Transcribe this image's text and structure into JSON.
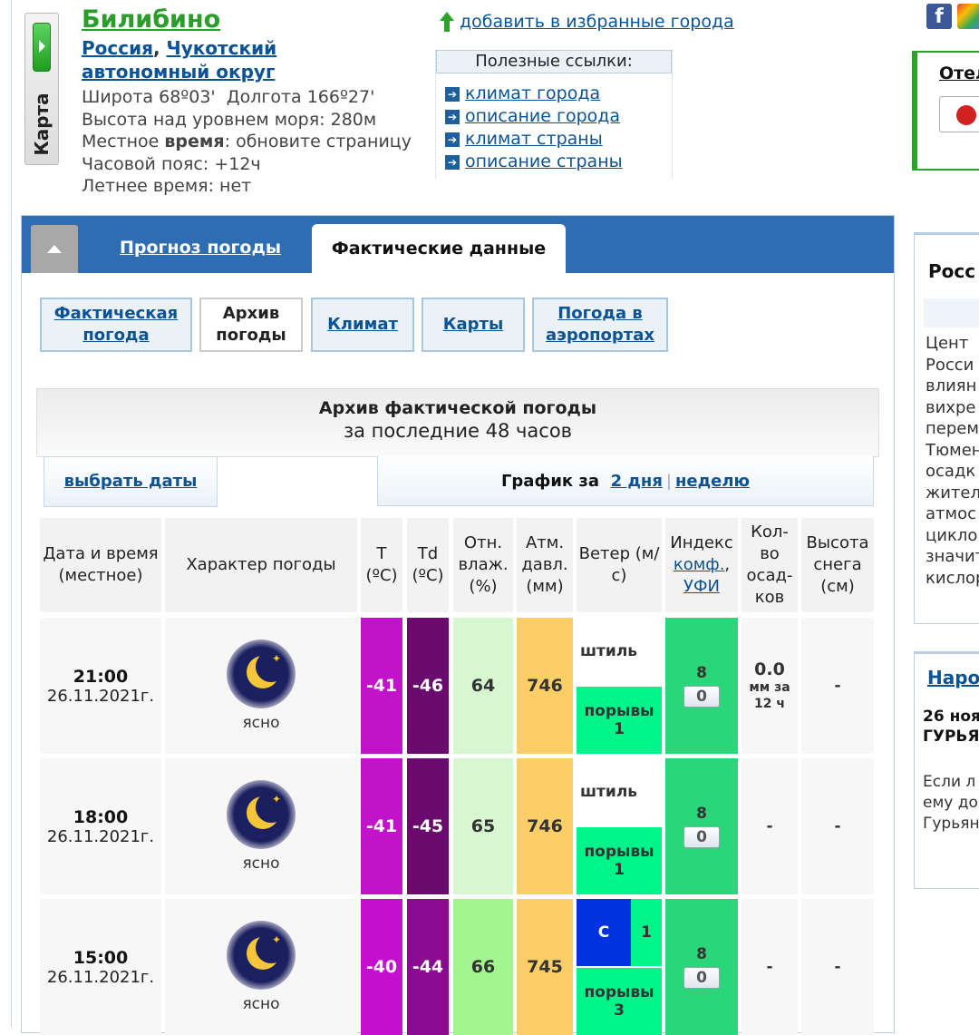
{
  "location": {
    "city": "Билибино",
    "country": "Россия",
    "region": "Чукотский автономный округ",
    "latitude": "Широта 68º03'",
    "longitude": "Долгота 166º27'",
    "altitude": "Высота над уровнем моря: 280м",
    "local_time_label": "Местное ",
    "local_time_bold": "время",
    "local_time_rest": ": обновите страницу",
    "timezone": "Часовой пояс: +12ч",
    "dst": "Летнее время: нет",
    "map_label": "Карта"
  },
  "favorites_link": "добавить в избранные города",
  "useful_links": {
    "title": "Полезные ссылки:",
    "items": [
      "климат города",
      "описание города",
      "климат страны",
      "описание страны"
    ]
  },
  "sidebar": {
    "hotels_title": "Отел",
    "news1_title": "Росс",
    "news1_text": "Цент\nРосси\nвлиян\nвихре\nперем\nТюмен\nосадк\nжител\nатмос\nцикло\nзначит\nкислор",
    "news2_title": "Наро",
    "news2_date": "26 ноя\nГУРЬЯ",
    "news2_text": "Если л\nему до\nГурьян"
  },
  "tabs": {
    "forecast": "Прогноз погоды",
    "actual": "Фактические данные"
  },
  "subtabs": [
    {
      "label": "Фактическая погода",
      "active": false
    },
    {
      "label": "Архив погоды",
      "active": true
    },
    {
      "label": "Климат",
      "active": false
    },
    {
      "label": "Карты",
      "active": false
    },
    {
      "label": "Погода в аэропортах",
      "active": false
    }
  ],
  "archive": {
    "title": "Архив фактической погоды",
    "subtitle": "за последние 48 часов",
    "select_dates": "выбрать даты",
    "graph_label": "График за",
    "graph_2days": "2 дня",
    "graph_week": "неделю"
  },
  "table": {
    "headers": {
      "datetime": "Дата и время (местное)",
      "conditions": "Характер погоды",
      "t": "T (ºC)",
      "td": "Td (ºC)",
      "humidity": "Отн. влаж. (%)",
      "pressure": "Атм. давл. (мм)",
      "wind": "Ветер (м/с)",
      "index_prefix": "Индекс",
      "index_link1": "комф.",
      "index_link2": "УФИ",
      "precip": "Кол-во осад-ков",
      "snow": "Высота снега (см)"
    },
    "rows": [
      {
        "time": "21:00",
        "date": "26.11.2021г.",
        "cond": "ясно",
        "t": "-41",
        "td": "-46",
        "hum": "64",
        "press": "746",
        "wind": "штиль",
        "wind_dir": "",
        "wind_speed": "",
        "gust_label": "порывы",
        "gust": "1",
        "comfort": "8",
        "uv": "0",
        "precip": "0.0",
        "precip_note": "мм за 12 ч",
        "snow": "-"
      },
      {
        "time": "18:00",
        "date": "26.11.2021г.",
        "cond": "ясно",
        "t": "-41",
        "td": "-45",
        "hum": "65",
        "press": "746",
        "wind": "штиль",
        "wind_dir": "",
        "wind_speed": "",
        "gust_label": "порывы",
        "gust": "1",
        "comfort": "8",
        "uv": "0",
        "precip": "-",
        "precip_note": "",
        "snow": "-"
      },
      {
        "time": "15:00",
        "date": "26.11.2021г.",
        "cond": "ясно",
        "t": "-40",
        "td": "-44",
        "hum": "66",
        "press": "745",
        "wind": "",
        "wind_dir": "С",
        "wind_speed": "1",
        "gust_label": "порывы",
        "gust": "3",
        "comfort": "8",
        "uv": "0",
        "precip": "-",
        "precip_note": "",
        "snow": "-"
      }
    ]
  },
  "colors": {
    "t_cell": "#c113c9",
    "t_cell_3": "#c50fcf",
    "td_cell": "#6b0a6e",
    "td_cell_3": "#8a0a90",
    "hum_cell_1": "#d6f7cf",
    "hum_cell_3": "#a3f58f",
    "press_cell": "#fccf66",
    "comfort_cell": "#2bd67b",
    "gust_cell": "#00f48a",
    "wind_dir_cell": "#0033e0"
  }
}
